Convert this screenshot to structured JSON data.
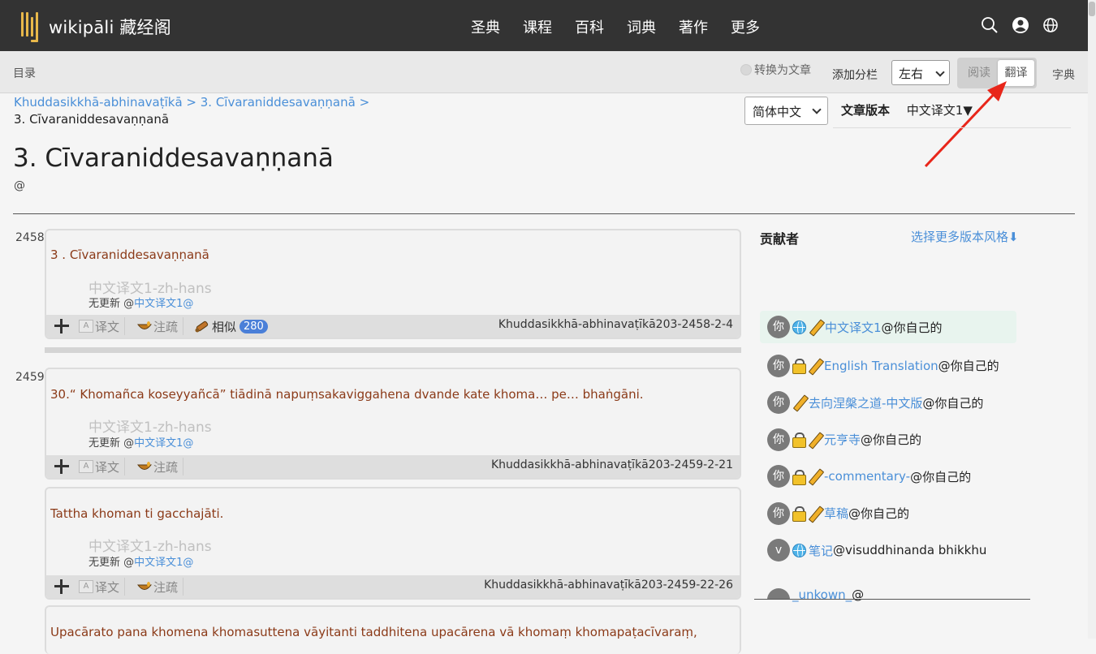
{
  "header": {
    "logo_text": "wikipāli 藏经阁",
    "nav": [
      "圣典",
      "课程",
      "百科",
      "词典",
      "著作",
      "更多"
    ]
  },
  "toolbar": {
    "toc": "目录",
    "convert": "转换为文章",
    "add_column": "添加分栏",
    "layout_value": "左右",
    "mode_read": "阅读",
    "mode_translate": "翻译",
    "dict": "字典"
  },
  "breadcrumb": {
    "item1": "Khuddasikkhā-abhinavaṭīkā",
    "sep1": " > ",
    "item2": "3. Cīvaraniddesavaṇṇanā",
    "sep2": " >",
    "current": "3. Cīvaraniddesavaṇṇanā"
  },
  "language_select": "简体中文",
  "version": {
    "label": "文章版本",
    "value": "中文译文1▼"
  },
  "title": "3. Cīvaraniddesavaṇṇanā",
  "title_sub": "@",
  "paragraphs": [
    {
      "num": "2458",
      "pali": "3 . Cīvaraniddesavaṇṇanā",
      "placeholder": "中文译文1-zh-hans",
      "update_prefix": "无更新 @",
      "update_link": "中文译文1@",
      "btn_translate": "译文",
      "btn_commentary": "注疏",
      "btn_similar": "相似",
      "similar_count": "280",
      "ref": "Khuddasikkhā-abhinavaṭīkā203-2458-2-4"
    },
    {
      "num": "2459",
      "pali": "30.“ Khomañca koseyyañcā” tiādinā napuṃsakaviggahena dvande kate khoma… pe… bhaṅgāni.",
      "placeholder": "中文译文1-zh-hans",
      "update_prefix": "无更新 @",
      "update_link": "中文译文1@",
      "btn_translate": "译文",
      "btn_commentary": "注疏",
      "ref": "Khuddasikkhā-abhinavaṭīkā203-2459-2-21"
    },
    {
      "num": "",
      "pali": "Tattha khoman ti gacchajāti.",
      "placeholder": "中文译文1-zh-hans",
      "update_prefix": "无更新 @",
      "update_link": "中文译文1@",
      "btn_translate": "译文",
      "btn_commentary": "注疏",
      "ref": "Khuddasikkhā-abhinavaṭīkā203-2459-22-26"
    },
    {
      "num": "",
      "pali": "Upacārato pana khomena khomasuttena vāyitanti taddhitena upacārena vā khomaṃ khomapaṭacīvaraṃ,"
    }
  ],
  "contributors": {
    "title": "贡献者",
    "more_versions": "选择更多版本风格⬇",
    "items": [
      {
        "avatar": "你",
        "icons": [
          "globe",
          "pencil"
        ],
        "link": "中文译文1",
        "suffix": "@你自己的",
        "selected": true
      },
      {
        "avatar": "你",
        "icons": [
          "lock",
          "pencil"
        ],
        "link": "English Translation",
        "suffix": "@你自己的"
      },
      {
        "avatar": "你",
        "icons": [
          "pencil"
        ],
        "link": "去向涅槃之道-中文版",
        "suffix": "@你自己的"
      },
      {
        "avatar": "你",
        "icons": [
          "lock",
          "pencil"
        ],
        "link": "元亨寺",
        "suffix": "@你自己的"
      },
      {
        "avatar": "你",
        "icons": [
          "lock",
          "pencil"
        ],
        "link": "-commentary-",
        "suffix": "@你自己的"
      },
      {
        "avatar": "你",
        "icons": [
          "lock",
          "pencil"
        ],
        "link": "草稿",
        "suffix": "@你自己的"
      },
      {
        "avatar": "v",
        "icons": [
          "globe"
        ],
        "link": "笔记",
        "suffix": "@visuddhinanda bhikkhu"
      },
      {
        "avatar": "",
        "icons": [],
        "link": "_unkown_",
        "suffix": "@"
      }
    ]
  }
}
